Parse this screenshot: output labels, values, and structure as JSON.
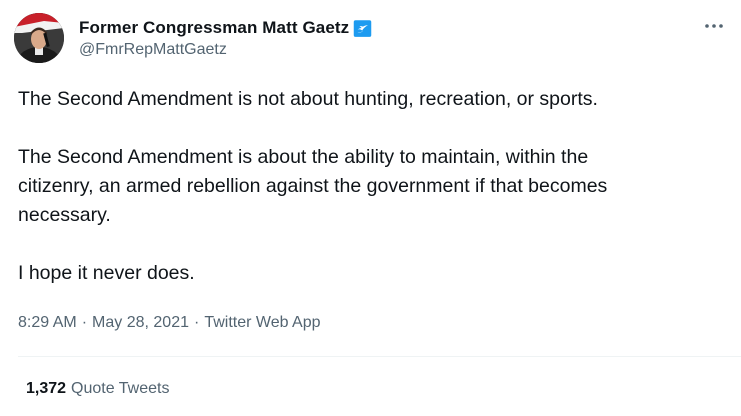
{
  "author": {
    "display_name": "Former Congressman Matt Gaetz",
    "handle": "@FmrRepMattGaetz",
    "verified_badge_icon": "verified-check-icon",
    "avatar_icon": "profile-photo"
  },
  "tweet": {
    "lines": [
      "The Second Amendment is not about hunting, recreation, or sports.",
      "The Second Amendment is about the ability to maintain, within the",
      "citizenry, an armed rebellion against the government if that becomes",
      "necessary.",
      "I hope it never does."
    ]
  },
  "meta": {
    "time": "8:29 AM",
    "separator": "·",
    "date": "May 28, 2021",
    "source": "Twitter Web App"
  },
  "engagement": {
    "quote_count": "1,372",
    "quote_label": "Quote Tweets"
  },
  "colors": {
    "text": "#0f1419",
    "secondary": "#536471",
    "verified": "#1d9bf0",
    "divider": "#eff3f4"
  }
}
